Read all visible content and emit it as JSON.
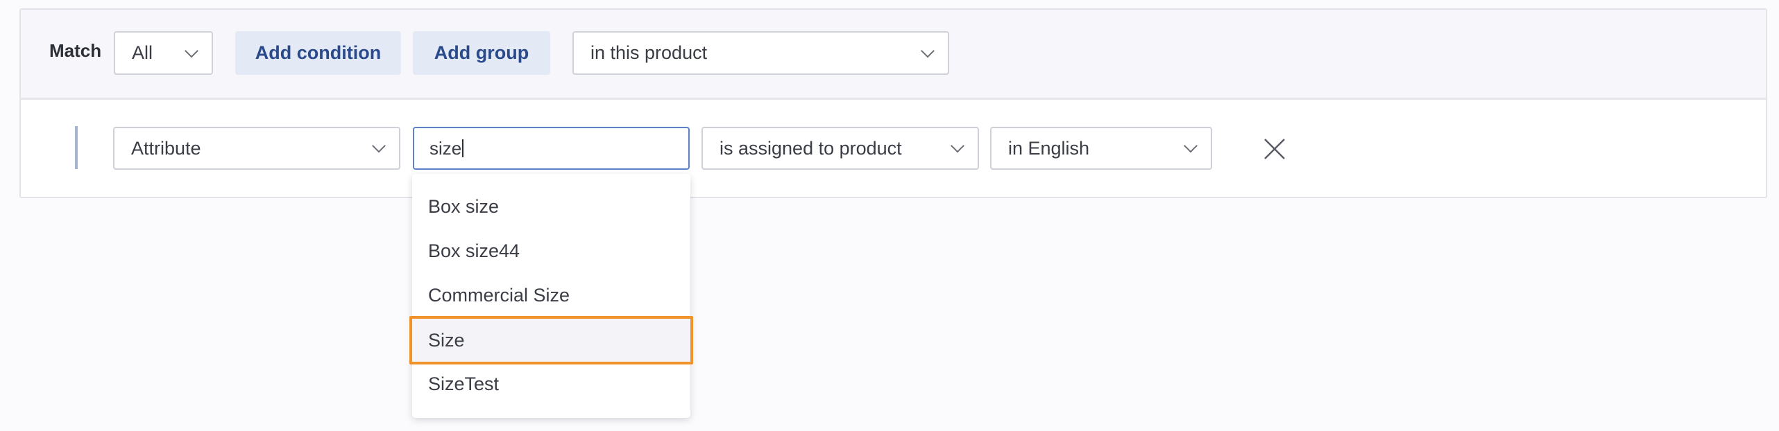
{
  "header": {
    "match_label": "Match",
    "match_select": "All",
    "add_condition_label": "Add condition",
    "add_group_label": "Add group",
    "scope_select": "in this product"
  },
  "condition": {
    "field_select": "Attribute",
    "search_value": "size",
    "operator_select": "is assigned to product",
    "language_select": "in English"
  },
  "dropdown": {
    "options": [
      "Box size",
      "Box size44",
      "Commercial Size",
      "Size",
      "SizeTest"
    ],
    "highlighted_index": 3
  },
  "colors": {
    "accent_border": "#5d80c6",
    "highlight_border": "#f0932b",
    "button_bg": "#e3e9f5",
    "button_text": "#2a4a8c"
  }
}
